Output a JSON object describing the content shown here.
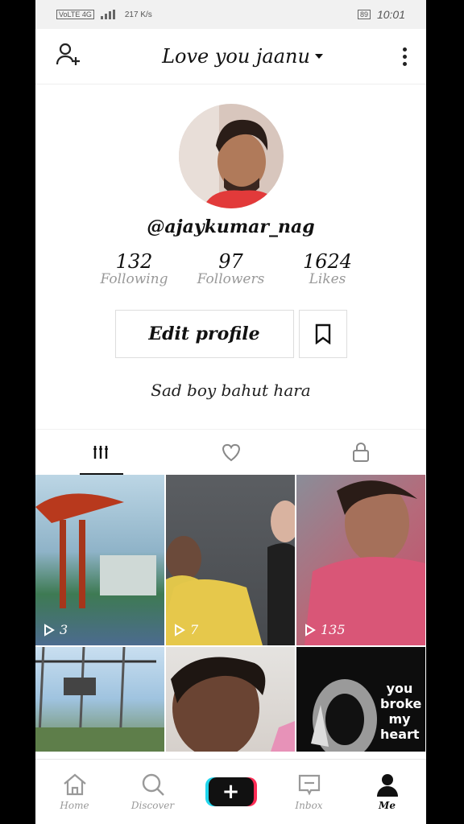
{
  "status_bar": {
    "network": "VoLTE 4G",
    "speed": "217 K/s",
    "battery": "89",
    "time": "10:01"
  },
  "header": {
    "title": "Love you jaanu"
  },
  "profile": {
    "handle": "@ajaykumar_nag",
    "bio": "Sad boy bahut hara"
  },
  "stats": [
    {
      "value": "132",
      "label": "Following"
    },
    {
      "value": "97",
      "label": "Followers"
    },
    {
      "value": "1624",
      "label": "Likes"
    }
  ],
  "buttons": {
    "edit_profile": "Edit profile"
  },
  "videos": [
    {
      "views": "3"
    },
    {
      "views": "7"
    },
    {
      "views": "135"
    },
    {
      "views": ""
    },
    {
      "views": ""
    },
    {
      "overlay_text": "you broke my heart"
    }
  ],
  "nav": {
    "home": "Home",
    "discover": "Discover",
    "create": "+",
    "inbox": "Inbox",
    "me": "Me"
  }
}
